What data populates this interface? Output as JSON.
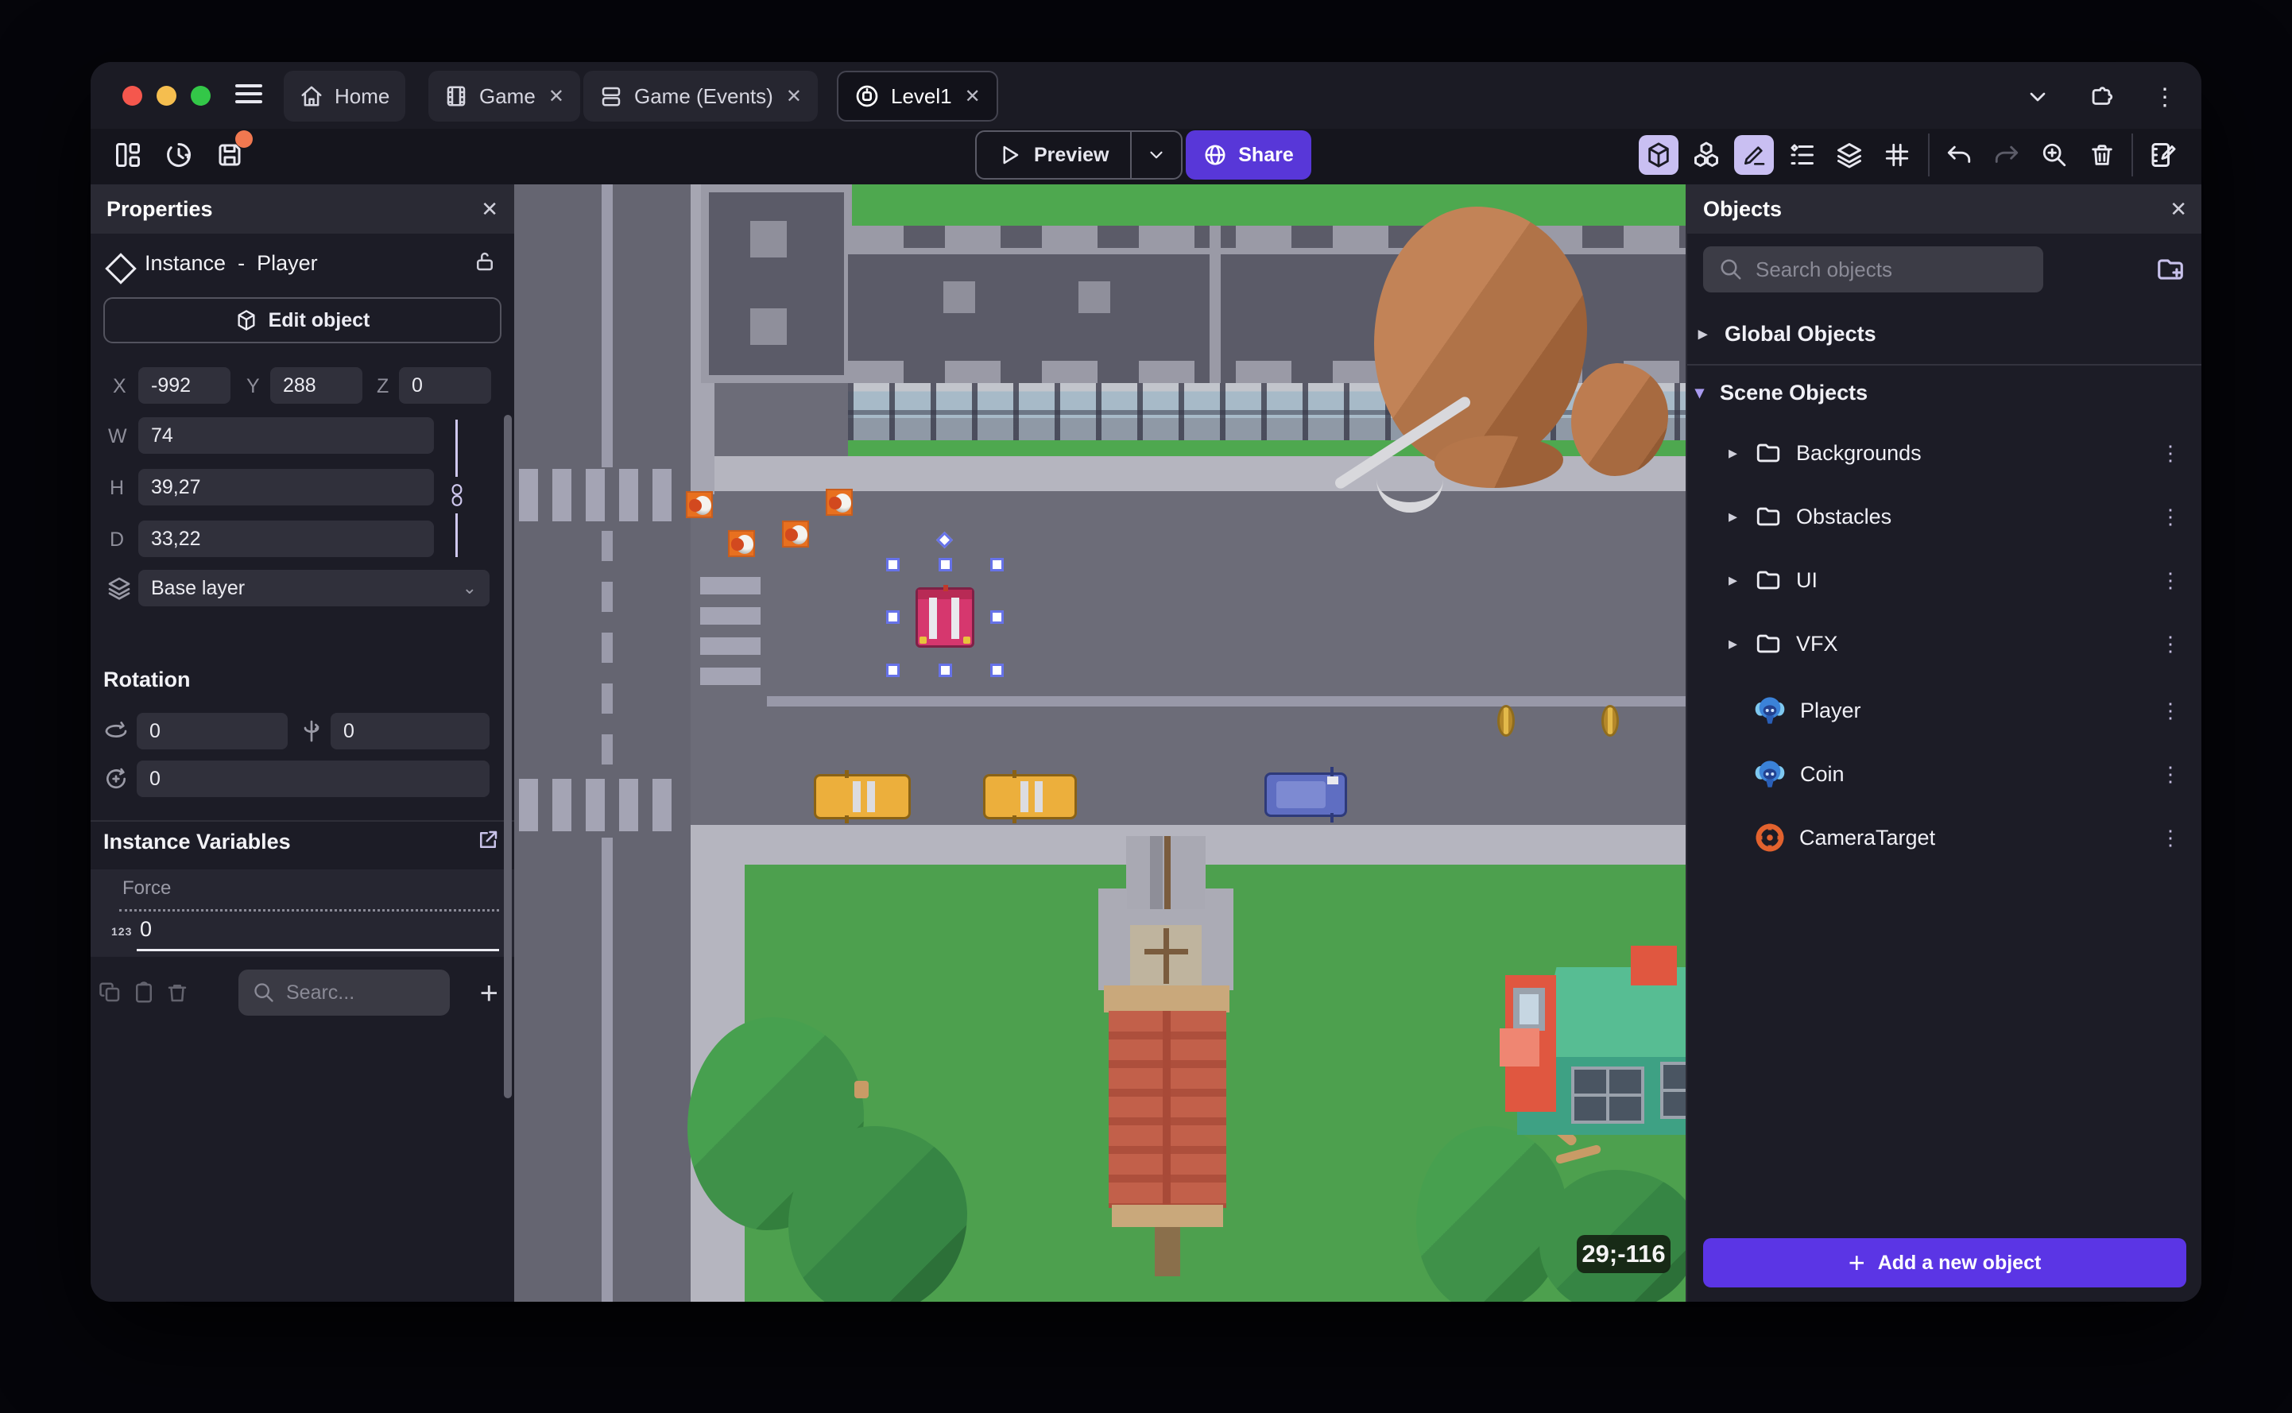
{
  "icons": {
    "close": "✕",
    "kebab": "⋮",
    "chevron_right": "▸",
    "chevron_down": "▾",
    "chevron_select": "⌄",
    "plus": "+"
  },
  "tabs": [
    {
      "label": "Home",
      "active": false,
      "closable": false
    },
    {
      "label": "Game",
      "active": false,
      "closable": true
    },
    {
      "label": "Game (Events)",
      "active": false,
      "closable": true
    },
    {
      "label": "Level1",
      "active": true,
      "closable": true
    }
  ],
  "toolbar": {
    "preview_label": "Preview",
    "share_label": "Share"
  },
  "properties_panel": {
    "title": "Properties",
    "instance_kind": "Instance",
    "separator": "-",
    "instance_name": "Player",
    "edit_object_label": "Edit object",
    "position": {
      "x_label": "X",
      "x_value": "-992",
      "y_label": "Y",
      "y_value": "288",
      "z_label": "Z",
      "z_value": "0"
    },
    "size": {
      "w_label": "W",
      "w_value": "74",
      "h_label": "H",
      "h_value": "39,27",
      "d_label": "D",
      "d_value": "33,22"
    },
    "layer_value": "Base layer",
    "rotation": {
      "title": "Rotation",
      "x_value": "0",
      "y_value": "0",
      "z_value": "0"
    },
    "instance_variables": {
      "title": "Instance Variables",
      "variables": [
        {
          "name": "Force",
          "type_badge": "123",
          "value": "0"
        }
      ],
      "search_placeholder": "Searc..."
    }
  },
  "objects_panel": {
    "title": "Objects",
    "search_placeholder": "Search objects",
    "global_group_label": "Global Objects",
    "scene_group_label": "Scene Objects",
    "tree": [
      {
        "label": "Backgrounds",
        "type": "folder"
      },
      {
        "label": "Obstacles",
        "type": "folder"
      },
      {
        "label": "UI",
        "type": "folder"
      },
      {
        "label": "VFX",
        "type": "folder"
      },
      {
        "label": "Player",
        "type": "object",
        "icon": "monkey"
      },
      {
        "label": "Coin",
        "type": "object",
        "icon": "monkey"
      },
      {
        "label": "CameraTarget",
        "type": "object",
        "icon": "camera-target"
      }
    ],
    "add_button_label": "Add a new object"
  },
  "canvas": {
    "cursor_coordinates": "29;-116"
  },
  "colors": {
    "accent_purple": "#5b35e5",
    "share_purple": "#5837d8",
    "active_tool_bg": "#c9bff2",
    "selection_blue": "#6672e8",
    "unsaved_dot": "#f07850",
    "grass_green": "#4da04e",
    "road_grey": "#6c6c78"
  }
}
